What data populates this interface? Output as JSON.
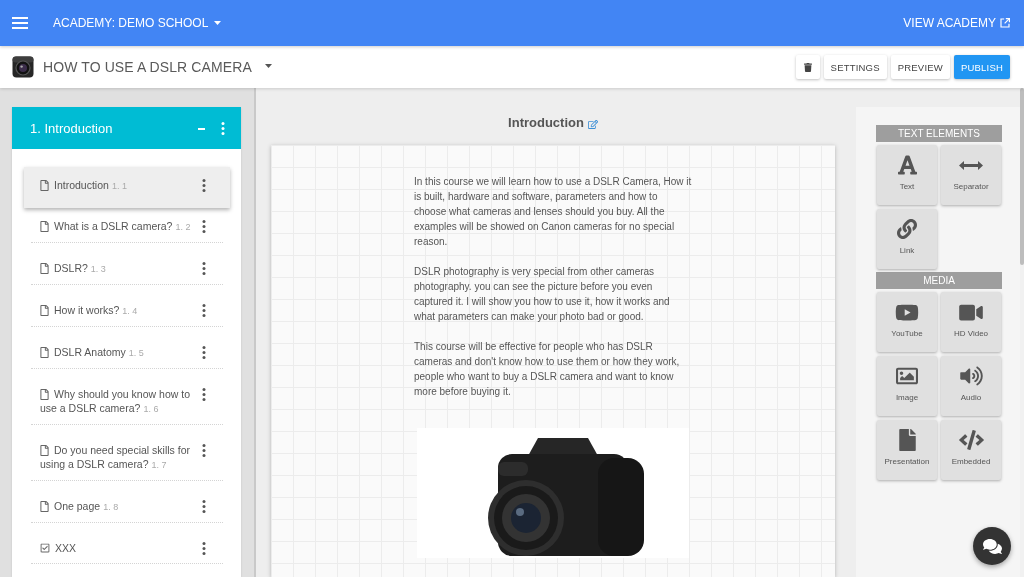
{
  "top_bar": {
    "academy": "ACADEMY: DEMO SCHOOL",
    "view_link": "VIEW ACADEMY"
  },
  "course_bar": {
    "title": "HOW TO USE A DSLR CAMERA",
    "buttons": [
      {
        "kind": "delete"
      },
      {
        "kind": "plain",
        "label": "SETTINGS"
      },
      {
        "kind": "plain",
        "label": "PREVIEW"
      },
      {
        "kind": "primary",
        "label": "PUBLISH"
      }
    ]
  },
  "chapter": {
    "title": "1. Introduction",
    "lessons": [
      {
        "kind": "page",
        "title": "Introduction",
        "number": "1. 1",
        "selected": true
      },
      {
        "kind": "page",
        "title": "What is a DSLR camera?",
        "number": "1. 2",
        "selected": false
      },
      {
        "kind": "page",
        "title": "DSLR?",
        "number": "1. 3",
        "selected": false
      },
      {
        "kind": "page",
        "title": "How it works?",
        "number": "1. 4",
        "selected": false
      },
      {
        "kind": "page",
        "title": "DSLR Anatomy",
        "number": "1. 5",
        "selected": false
      },
      {
        "kind": "page",
        "title": "Why should you know how to use a DSLR camera?",
        "number": "1. 6",
        "selected": false
      },
      {
        "kind": "page",
        "title": "Do you need special skills for using a DSLR camera?",
        "number": "1. 7",
        "selected": false
      },
      {
        "kind": "page",
        "title": "One page",
        "number": "1. 8",
        "selected": false
      },
      {
        "kind": "quiz",
        "title": "XXX",
        "selected": false
      }
    ]
  },
  "editor": {
    "heading": "Introduction",
    "paragraphs": [
      "In this course we will learn how to use a DSLR Camera, How it is built, hardware and software, parameters and how to choose what cameras and lenses should you buy. All the examples will be showed on Canon cameras for no special reason.",
      "DSLR photography is very special from other cameras photography. you can see the picture before you even captured it. I will show you how to use it, how it works and what parameters can make your photo bad or good.",
      "This course will be effective for people who has DSLR cameras and don't know how to use them or how they work, people who want to buy a DSLR camera and want to know more before buying it."
    ]
  },
  "tools": [
    {
      "title": "TEXT ELEMENTS",
      "items": [
        {
          "kind": "text",
          "label": "Text"
        },
        {
          "kind": "separator",
          "label": "Separator"
        },
        {
          "kind": "link",
          "label": "Link"
        }
      ]
    },
    {
      "title": "MEDIA",
      "items": [
        {
          "kind": "youtube",
          "label": "YouTube"
        },
        {
          "kind": "video",
          "label": "HD Video"
        },
        {
          "kind": "image",
          "label": "Image"
        },
        {
          "kind": "audio",
          "label": "Audio"
        },
        {
          "kind": "presentation",
          "label": "Presentation"
        },
        {
          "kind": "embedded",
          "label": "Embedded"
        }
      ]
    }
  ]
}
